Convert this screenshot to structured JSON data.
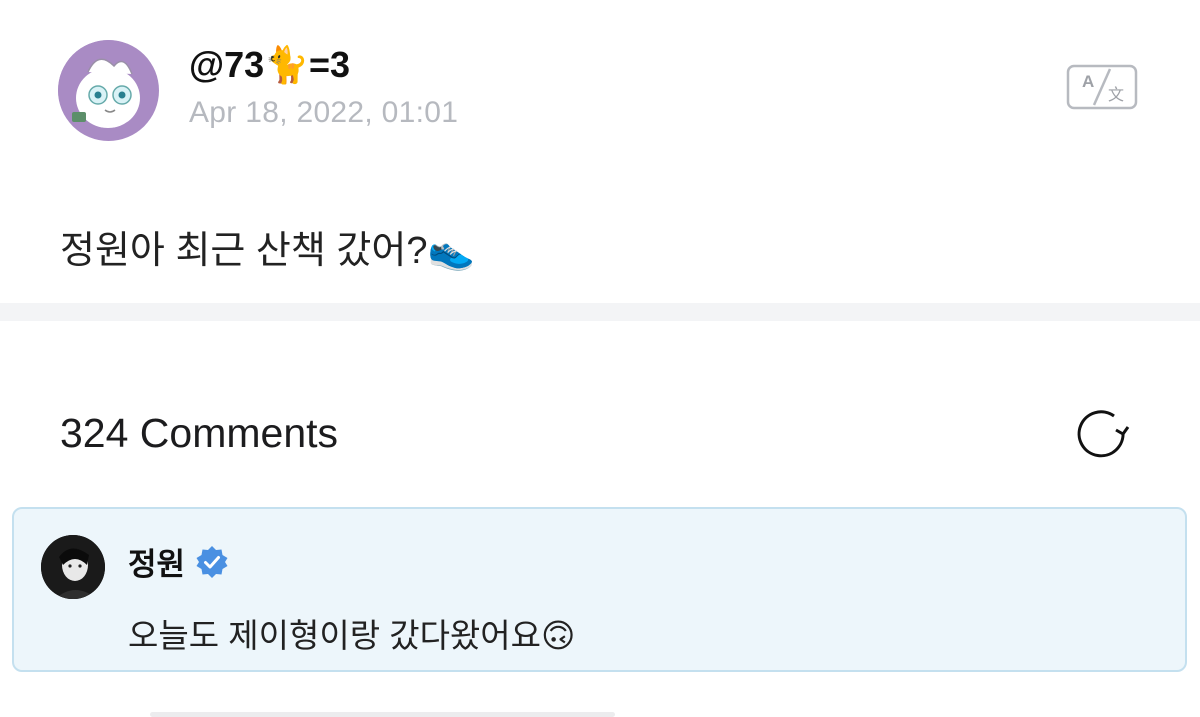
{
  "post": {
    "author": "@73🐈=3",
    "date": "Apr 18, 2022, 01:01",
    "body": "정원아 최근 산책 갔어?👟",
    "avatar_icon": "jigglypuff-avatar-icon",
    "translate_icon": "translate-icon"
  },
  "comments": {
    "count_label": "324 Comments",
    "refresh_icon": "refresh-icon"
  },
  "featured_comment": {
    "author": "정원",
    "verified_icon": "verified-badge-icon",
    "text": "오늘도 제이형이랑 갔다왔어요🙃"
  },
  "colors": {
    "avatar_bg": "#a98bc4",
    "date_text": "#b6b9bf",
    "comment_bg": "#edf6fb",
    "comment_border": "#c4e0ef",
    "verified_blue": "#4a90e2"
  }
}
